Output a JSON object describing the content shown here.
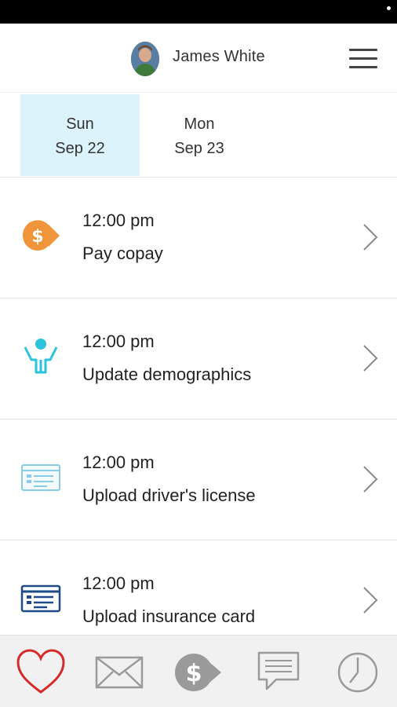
{
  "header": {
    "user_name": "James White"
  },
  "date_tabs": [
    {
      "day": "Sun",
      "date": "Sep 22",
      "active": true
    },
    {
      "day": "Mon",
      "date": "Sep 23",
      "active": false
    }
  ],
  "tasks": [
    {
      "time": "12:00 pm",
      "title": "Pay copay",
      "icon": "dollar-tag-icon"
    },
    {
      "time": "12:00 pm",
      "title": "Update demographics",
      "icon": "person-icon"
    },
    {
      "time": "12:00 pm",
      "title": "Upload driver's license",
      "icon": "id-card-icon"
    },
    {
      "time": "12:00 pm",
      "title": "Upload insurance card",
      "icon": "insurance-card-icon"
    }
  ],
  "bottom_nav": [
    {
      "icon": "heart-icon"
    },
    {
      "icon": "mail-icon"
    },
    {
      "icon": "dollar-tag-icon"
    },
    {
      "icon": "chat-icon"
    },
    {
      "icon": "clock-icon"
    }
  ],
  "colors": {
    "active_tab_bg": "#dcf3fb",
    "copay_orange": "#f0953a",
    "person_teal": "#2cc3dc",
    "id_card_blue": "#8ccbe6",
    "insurance_navy": "#1f4a86",
    "heart_red": "#d42a2a",
    "nav_gray": "#9a9a9a"
  }
}
